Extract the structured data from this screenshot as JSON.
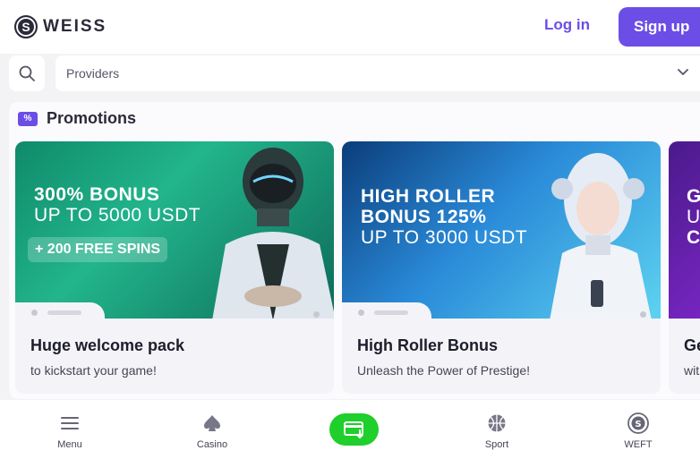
{
  "header": {
    "logo_text": "WEISS",
    "logo_mark": "S",
    "login_label": "Log in",
    "signup_label": "Sign up"
  },
  "filters": {
    "search_icon": "search-icon",
    "providers_label": "Providers"
  },
  "promotions": {
    "title": "Promotions",
    "icon": "%",
    "cards": [
      {
        "banner_line1": "300% BONUS",
        "banner_line2": "UP TO 5000 USDT",
        "banner_badge": "+ 200 FREE SPINS",
        "title": "Huge welcome pack",
        "subtitle": "to kickstart your game!"
      },
      {
        "banner_line1": "HIGH ROLLER",
        "banner_line2": "BONUS 125%",
        "banner_line3": "UP TO 3000 USDT",
        "title": "High Roller Bonus",
        "subtitle": "Unleash the Power of Prestige!"
      },
      {
        "banner_line1": "G",
        "banner_line2": "U",
        "banner_line3": "C",
        "title": "Ge",
        "subtitle": "wit"
      }
    ]
  },
  "bottom_nav": {
    "items": [
      {
        "label": "Menu",
        "icon": "menu-icon"
      },
      {
        "label": "Casino",
        "icon": "spade-icon"
      },
      {
        "label": "",
        "icon": "deposit-icon"
      },
      {
        "label": "Sport",
        "icon": "basketball-icon"
      },
      {
        "label": "WEFT",
        "icon": "weft-coin-icon"
      }
    ]
  },
  "colors": {
    "accent": "#6c4de6",
    "deposit": "#1fcf2b"
  }
}
